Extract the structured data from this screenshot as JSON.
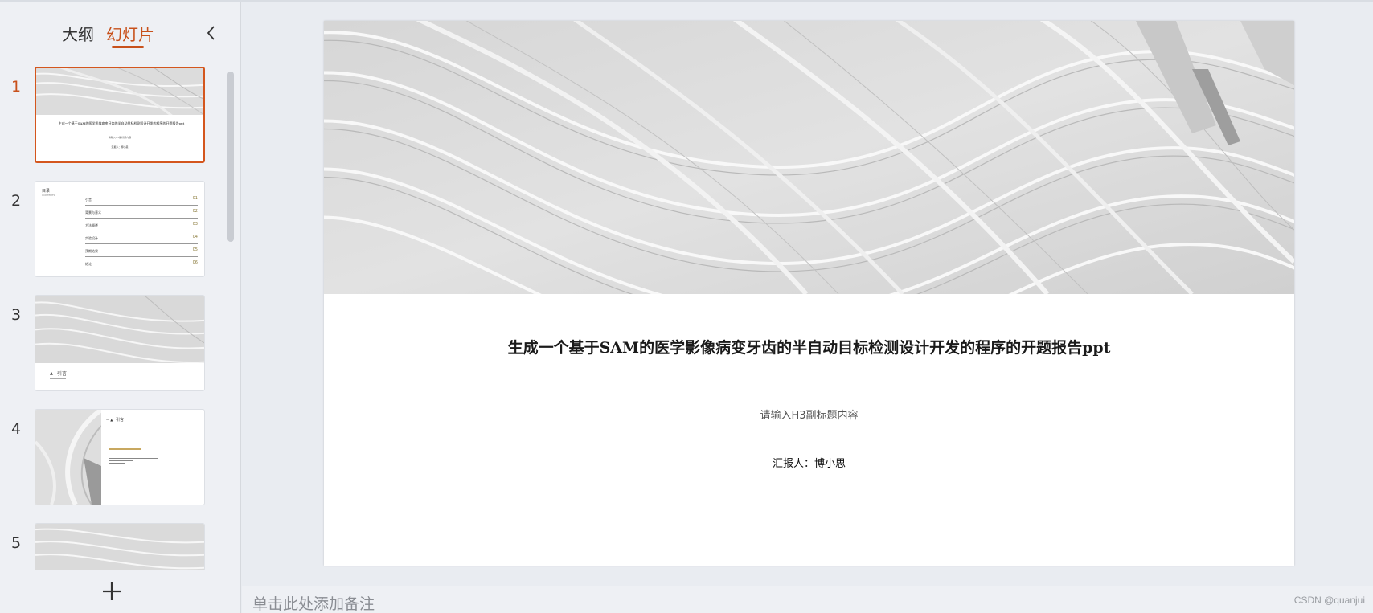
{
  "panel": {
    "tabs": [
      {
        "label": "大纲",
        "active": false
      },
      {
        "label": "幻灯片",
        "active": true
      }
    ],
    "accent_color": "#c8511b",
    "thumbnails": [
      {
        "number": "1",
        "active": true,
        "title": "生成一个基于SAM的医学影像病变牙齿的半自动目标检测设计开发的程序的开题报告ppt",
        "subtitle": "请输入H3副标题内容",
        "presenter": "汇报人：博小思"
      },
      {
        "number": "2",
        "active": false,
        "heading": "目录",
        "sub": "CONTENTS",
        "items": [
          "引言",
          "背景与意义",
          "方法概述",
          "实验设计",
          "预期结果",
          "结论"
        ]
      },
      {
        "number": "3",
        "active": false,
        "heading": "引言"
      },
      {
        "number": "4",
        "active": false,
        "heading": "引言"
      },
      {
        "number": "5",
        "active": false
      }
    ]
  },
  "slide": {
    "title": "生成一个基于SAM的医学影像病变牙齿的半自动目标检测设计开发的程序的开题报告ppt",
    "subtitle": "请输入H3副标题内容",
    "presenter": "汇报人：博小思"
  },
  "notes": {
    "placeholder": "单击此处添加备注"
  },
  "watermark": "CSDN @quanjui"
}
